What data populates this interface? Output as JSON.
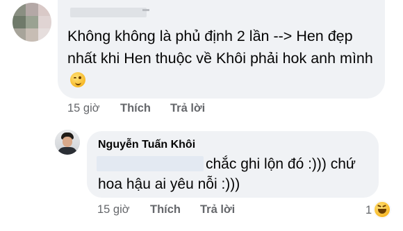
{
  "comment": {
    "author_redacted": true,
    "text": "Không không là phủ định 2 lần --> Hen đẹp nhất khi Hen thuộc về Khôi phải hok anh mình",
    "emoji": "wink-emoji",
    "time": "15 giờ",
    "like_label": "Thích",
    "reply_label": "Trả lời"
  },
  "reply": {
    "author": "Nguyễn Tuấn Khôi",
    "mention_redacted": true,
    "text_line_1": "chắc ghi lộn đó :))) chứ",
    "text_line_2": "hoa hậu ai yêu nỗi :)))",
    "time": "15 giờ",
    "like_label": "Thích",
    "reply_label": "Trả lời",
    "reaction_count": "1",
    "reaction_icon": "haha-reaction-icon"
  },
  "colors": {
    "bubble": "#f0f2f5",
    "meta_text": "#65676b",
    "body_text": "#050505",
    "reaction_yellow": "#f7b928"
  }
}
